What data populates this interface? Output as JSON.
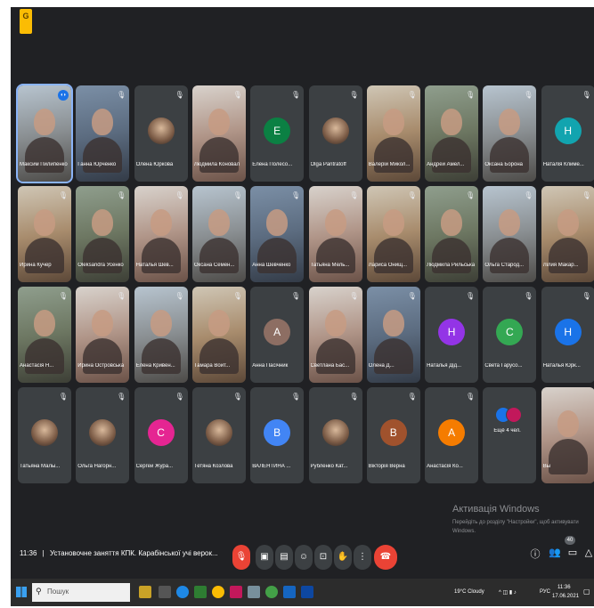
{
  "app": {
    "logo_label": "G"
  },
  "participants": [
    {
      "name": "Максим Пилипенко",
      "type": "video",
      "tone": "c1",
      "speaking": true
    },
    {
      "name": "Ганна Юрченко",
      "type": "video",
      "tone": "c5"
    },
    {
      "name": "Олена Юркова",
      "type": "avatar",
      "avatar_style": "photo"
    },
    {
      "name": "Людмила Коновал",
      "type": "video",
      "tone": "c4"
    },
    {
      "name": "Елена Полесо...",
      "type": "avatar",
      "initial": "E",
      "color": "#0b8043"
    },
    {
      "name": "Olga Pantratoff",
      "type": "avatar",
      "avatar_style": "photo"
    },
    {
      "name": "Валерій Микол...",
      "type": "video",
      "tone": "c2"
    },
    {
      "name": "Андрей Амел...",
      "type": "video",
      "tone": "c3"
    },
    {
      "name": "Оксана Борона",
      "type": "video",
      "tone": "c1"
    },
    {
      "name": "Наталія Климе...",
      "type": "avatar",
      "initial": "Н",
      "color": "#12a4af"
    },
    {
      "name": "Ирина Кучер",
      "type": "video",
      "tone": "c2"
    },
    {
      "name": "Oleksandra Усенко",
      "type": "video",
      "tone": "c3"
    },
    {
      "name": "Наталья Шев...",
      "type": "video",
      "tone": "c4"
    },
    {
      "name": "Оксана Семен...",
      "type": "video",
      "tone": "c1"
    },
    {
      "name": "Анна Шевченко",
      "type": "video",
      "tone": "c5"
    },
    {
      "name": "Татьяна Мель...",
      "type": "video",
      "tone": "c4"
    },
    {
      "name": "Лариса Онищ...",
      "type": "video",
      "tone": "c2"
    },
    {
      "name": "Людмила Рильська",
      "type": "video",
      "tone": "c3"
    },
    {
      "name": "Ольга Старод...",
      "type": "video",
      "tone": "c1"
    },
    {
      "name": "Лілия Макар...",
      "type": "video",
      "tone": "c2"
    },
    {
      "name": "Анастасія Н...",
      "type": "video",
      "tone": "c3"
    },
    {
      "name": "Ирина Островська",
      "type": "video",
      "tone": "c4"
    },
    {
      "name": "Елена Кривен...",
      "type": "video",
      "tone": "c1"
    },
    {
      "name": "Тамара Войт...",
      "type": "video",
      "tone": "c2"
    },
    {
      "name": "Анна Пасічник",
      "type": "avatar",
      "initial": "А",
      "color": "#8d6e63"
    },
    {
      "name": "Светлана Бас...",
      "type": "video",
      "tone": "c4"
    },
    {
      "name": "Олена Д...",
      "type": "video",
      "tone": "c5"
    },
    {
      "name": "Наталья Дід...",
      "type": "avatar",
      "initial": "Н",
      "color": "#9334e6"
    },
    {
      "name": "Света Гарусо...",
      "type": "avatar",
      "initial": "С",
      "color": "#34a853"
    },
    {
      "name": "Наталья Юрк...",
      "type": "avatar",
      "initial": "Н",
      "color": "#1a73e8"
    },
    {
      "name": "Татьяна Малы...",
      "type": "avatar",
      "avatar_style": "photo"
    },
    {
      "name": "Ольга Нагорн...",
      "type": "avatar",
      "avatar_style": "photo"
    },
    {
      "name": "Сергей Жура...",
      "type": "avatar",
      "initial": "С",
      "color": "#e52592"
    },
    {
      "name": "Тетяна Козлова",
      "type": "avatar",
      "avatar_style": "photo"
    },
    {
      "name": "ВАЛЕНТИНА ...",
      "type": "avatar",
      "initial": "В",
      "color": "#4285f4"
    },
    {
      "name": "Рубленко Кат...",
      "type": "avatar",
      "avatar_style": "photo"
    },
    {
      "name": "Вікторія Верна",
      "type": "avatar",
      "initial": "В",
      "color": "#a0522d"
    },
    {
      "name": "Анастасія Ко...",
      "type": "avatar",
      "initial": "А",
      "color": "#f57c00"
    },
    {
      "name": "Ещё 4 чел.",
      "type": "others"
    },
    {
      "name": "Вы",
      "type": "video",
      "tone": "c4",
      "self": true
    }
  ],
  "watermark": {
    "title": "Активація Windows",
    "text": "Перейдіть до розділу \"Настройки\", щоб активувати Windows."
  },
  "meeting": {
    "time": "11:36",
    "separator": "|",
    "title": "Установочне заняття КПК. Карабінської учі верок..."
  },
  "participant_count": "40",
  "taskbar": {
    "search_placeholder": "Пошук",
    "weather": "19°C Cloudy",
    "lang": "РУС",
    "clock_time": "11:36",
    "clock_date": "17.06.2021"
  },
  "colors": {
    "background": "#202124",
    "tile": "#3c4043",
    "red": "#ea4335",
    "accent": "#8ab4f8"
  }
}
